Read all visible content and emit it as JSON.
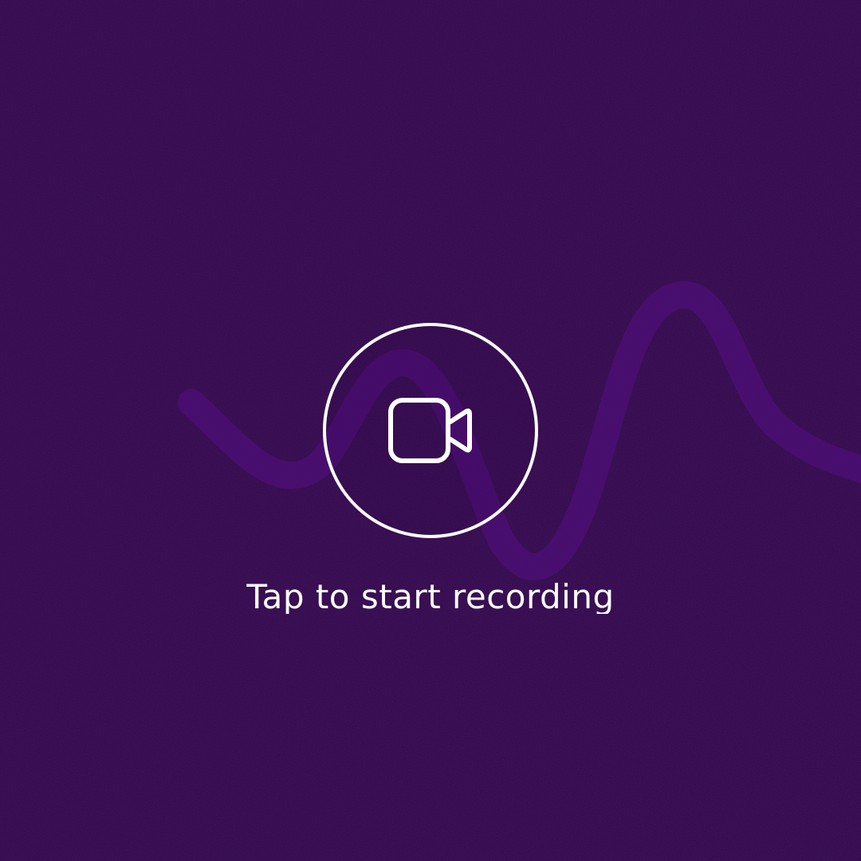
{
  "recorder": {
    "prompt": "Tap to start recording",
    "icon": "video-camera-icon",
    "colors": {
      "background": "#31064a",
      "wave": "#4e0f78",
      "foreground": "#ffffff"
    }
  }
}
